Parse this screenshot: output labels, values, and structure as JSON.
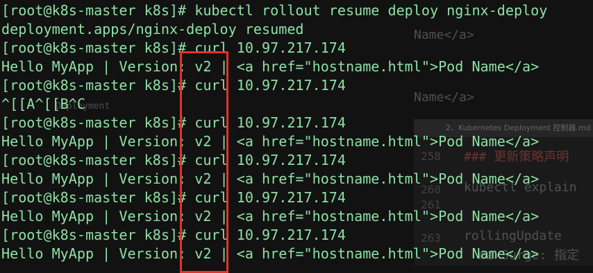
{
  "terminal": {
    "lines": [
      "[root@k8s-master k8s]# kubectl rollout resume deploy nginx-deploy",
      "deployment.apps/nginx-deploy resumed",
      "[root@k8s-master k8s]# curl 10.97.217.174",
      "Hello MyApp | Version: v2 | <a href=\"hostname.html\">Pod Name</a>",
      "[root@k8s-master k8s]# curl 10.97.217.174",
      "^[[A^[[B^C",
      "[root@k8s-master k8s]# curl 10.97.217.174",
      "Hello MyApp | Version: v2 | <a href=\"hostname.html\">Pod Name</a>",
      "[root@k8s-master k8s]# curl 10.97.217.174",
      "Hello MyApp | Version: v2 | <a href=\"hostname.html\">Pod Name</a>",
      "[root@k8s-master k8s]# curl 10.97.217.174",
      "Hello MyApp | Version: v2 | <a href=\"hostname.html\">Pod Name</a>",
      "[root@k8s-master k8s]# curl 10.97.217.174",
      "Hello MyApp | Version: v2 | <a href=\"hostname.html\">Pod Name</a>"
    ],
    "text_color": "#8fe0a4",
    "background_color": "#121212"
  },
  "annotation": {
    "color": "#e4322b"
  },
  "background_window": {
    "snippets": [
      "Name</a>",
      "Name</a>",
      "Deployment"
    ],
    "tab_title": "2、Kubernetes Deployment 控制器.md",
    "line_numbers": [
      "258",
      "260",
      "261",
      "263"
    ],
    "code_lines": [
      "### 更新策略声明",
      "kubectl explain",
      "rollingUpdate",
      "  maxSurge: 指定"
    ]
  }
}
